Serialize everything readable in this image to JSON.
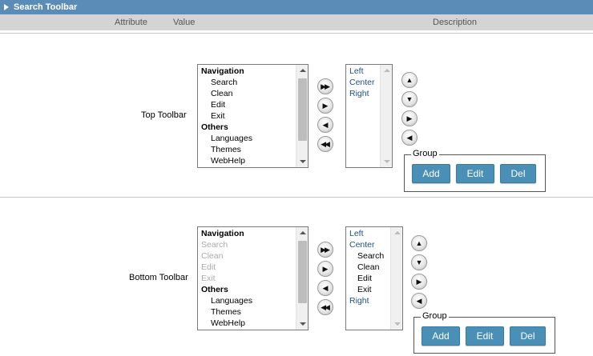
{
  "title": "Search Toolbar",
  "columns": {
    "attribute": "Attribute",
    "value": "Value",
    "description": "Description"
  },
  "top": {
    "label": "Top Toolbar",
    "available": [
      {
        "text": "Navigation",
        "kind": "grp"
      },
      {
        "text": "Search",
        "kind": "sub"
      },
      {
        "text": "Clean",
        "kind": "sub"
      },
      {
        "text": "Edit",
        "kind": "sub"
      },
      {
        "text": "Exit",
        "kind": "sub"
      },
      {
        "text": "Others",
        "kind": "grp"
      },
      {
        "text": "Languages",
        "kind": "sub"
      },
      {
        "text": "Themes",
        "kind": "sub"
      },
      {
        "text": "WebHelp",
        "kind": "sub"
      }
    ],
    "selected": [
      {
        "text": "Left",
        "kind": "blue"
      },
      {
        "text": "Center",
        "kind": "blue"
      },
      {
        "text": "Right",
        "kind": "blue"
      }
    ],
    "group": {
      "legend": "Group",
      "add": "Add",
      "edit": "Edit",
      "del": "Del"
    }
  },
  "bottom": {
    "label": "Bottom Toolbar",
    "available": [
      {
        "text": "Navigation",
        "kind": "grp"
      },
      {
        "text": "Search",
        "kind": "dis"
      },
      {
        "text": "Clean",
        "kind": "dis"
      },
      {
        "text": "Edit",
        "kind": "dis"
      },
      {
        "text": "Exit",
        "kind": "dis"
      },
      {
        "text": "Others",
        "kind": "grp"
      },
      {
        "text": "Languages",
        "kind": "sub"
      },
      {
        "text": "Themes",
        "kind": "sub"
      },
      {
        "text": "WebHelp",
        "kind": "sub"
      }
    ],
    "selected": [
      {
        "text": "Left",
        "kind": "blue"
      },
      {
        "text": "Center",
        "kind": "blue"
      },
      {
        "text": "Search",
        "kind": "bluesub"
      },
      {
        "text": "Clean",
        "kind": "bluesub"
      },
      {
        "text": "Edit",
        "kind": "bluesub"
      },
      {
        "text": "Exit",
        "kind": "bluesub"
      },
      {
        "text": "Right",
        "kind": "blue"
      }
    ],
    "group": {
      "legend": "Group",
      "add": "Add",
      "edit": "Edit",
      "del": "Del"
    }
  },
  "icons": {
    "header_toggle": "collapse-triangle-icon",
    "add_all": "double-right-icon",
    "add_one": "right-icon",
    "remove_one": "left-icon",
    "remove_all": "double-left-icon",
    "move_up": "up-icon",
    "move_down": "down-icon",
    "indent": "right-icon",
    "outdent": "left-icon"
  },
  "colors": {
    "titlebar": "#5b8cb8",
    "button": "#4a8fb5",
    "header": "#d4d4d4"
  }
}
